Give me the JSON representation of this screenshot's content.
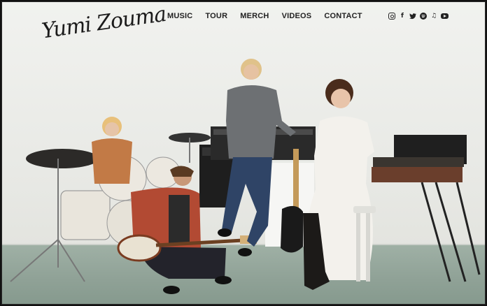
{
  "brand": {
    "logo_text": "Yumi Zouma"
  },
  "nav": {
    "items": [
      {
        "label": "MUSIC"
      },
      {
        "label": "TOUR"
      },
      {
        "label": "MERCH"
      },
      {
        "label": "VIDEOS"
      },
      {
        "label": "CONTACT"
      }
    ]
  },
  "social": {
    "icons": [
      "instagram-icon",
      "facebook-icon",
      "twitter-icon",
      "spotify-icon",
      "apple-music-icon",
      "youtube-icon"
    ]
  },
  "hero": {
    "description_icon": "band-photo"
  },
  "colors": {
    "wall": "#ecedea",
    "floor": "#8fa196",
    "text": "#222222"
  }
}
